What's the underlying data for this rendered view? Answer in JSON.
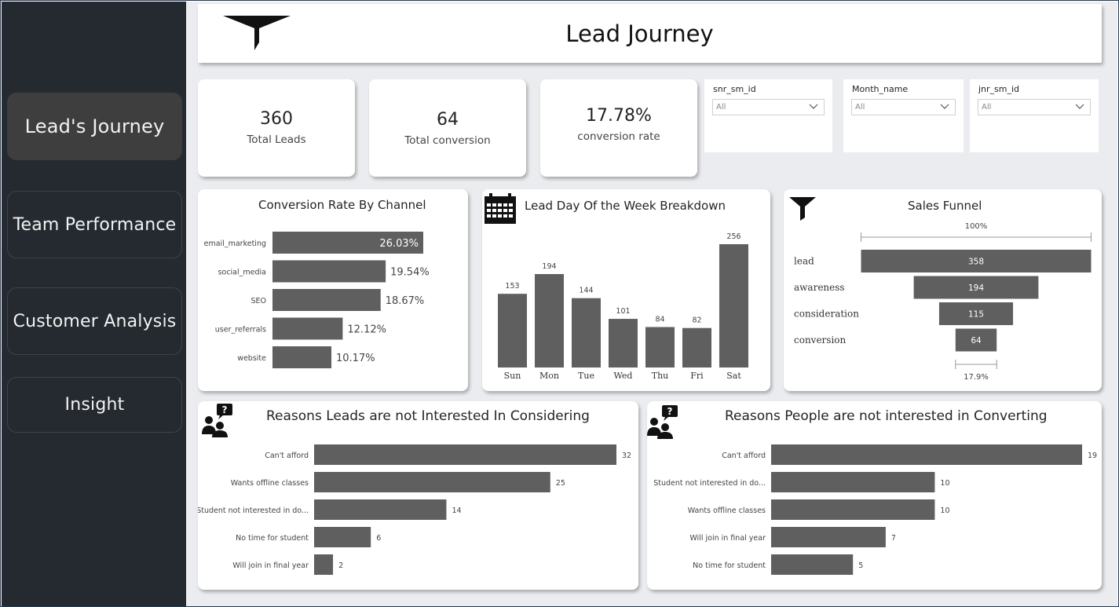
{
  "page": {
    "title": "Lead Journey"
  },
  "nav": {
    "items": [
      {
        "label": "Lead's Journey",
        "active": true
      },
      {
        "label": "Team Performance",
        "active": false
      },
      {
        "label": "Customer Analysis",
        "active": false
      },
      {
        "label": "Insight",
        "active": false
      }
    ]
  },
  "kpis": [
    {
      "value": "360",
      "label": "Total Leads"
    },
    {
      "value": "64",
      "label": "Total conversion"
    },
    {
      "value": "17.78%",
      "label": "conversion rate"
    }
  ],
  "slicers": [
    {
      "title": "snr_sm_id",
      "selected": "All"
    },
    {
      "title": "Month_name",
      "selected": "All"
    },
    {
      "title": "jnr_sm_id",
      "selected": "All"
    }
  ],
  "colors": {
    "bar": "#5f5f5f",
    "sidebar": "#252a31",
    "canvas": "#eaecef",
    "active_nav": "#3e3e3e"
  },
  "icons": {
    "header": "funnel-icon",
    "calendar": "calendar-icon",
    "funnel": "funnel-icon",
    "reasons": "people-question-icon"
  },
  "chart_data": [
    {
      "type": "bar",
      "orientation": "horizontal",
      "title": "Conversion Rate By Channel",
      "categories": [
        "email_marketing",
        "social_media",
        "SEO",
        "user_referrals",
        "website"
      ],
      "values": [
        26.03,
        19.54,
        18.67,
        12.12,
        10.17
      ],
      "labels": [
        "26.03%",
        "19.54%",
        "18.67%",
        "12.12%",
        "10.17%"
      ]
    },
    {
      "type": "bar",
      "title": "Lead Day Of the Week Breakdown",
      "categories": [
        "Sun",
        "Mon",
        "Tue",
        "Wed",
        "Thu",
        "Fri",
        "Sat"
      ],
      "values": [
        153,
        194,
        144,
        101,
        84,
        82,
        256
      ]
    },
    {
      "type": "bar",
      "subtype": "funnel",
      "title": "Sales Funnel",
      "categories": [
        "lead",
        "awareness",
        "consideration",
        "conversion"
      ],
      "values": [
        358,
        194,
        115,
        64
      ],
      "top_label": "100%",
      "bottom_label": "17.9%"
    },
    {
      "type": "bar",
      "orientation": "horizontal",
      "title": "Reasons Leads are not Interested In Considering",
      "categories": [
        "Can't afford",
        "Wants offline classes",
        "Student not interested in do...",
        "No time for student",
        "Will join in final year"
      ],
      "values": [
        32,
        25,
        14,
        6,
        2
      ]
    },
    {
      "type": "bar",
      "orientation": "horizontal",
      "title": "Reasons People are not interested in Converting",
      "categories": [
        "Can't afford",
        "Student not interested in do...",
        "Wants offline classes",
        "Will join in final year",
        "No time for student"
      ],
      "values": [
        19,
        10,
        10,
        7,
        5
      ]
    }
  ]
}
